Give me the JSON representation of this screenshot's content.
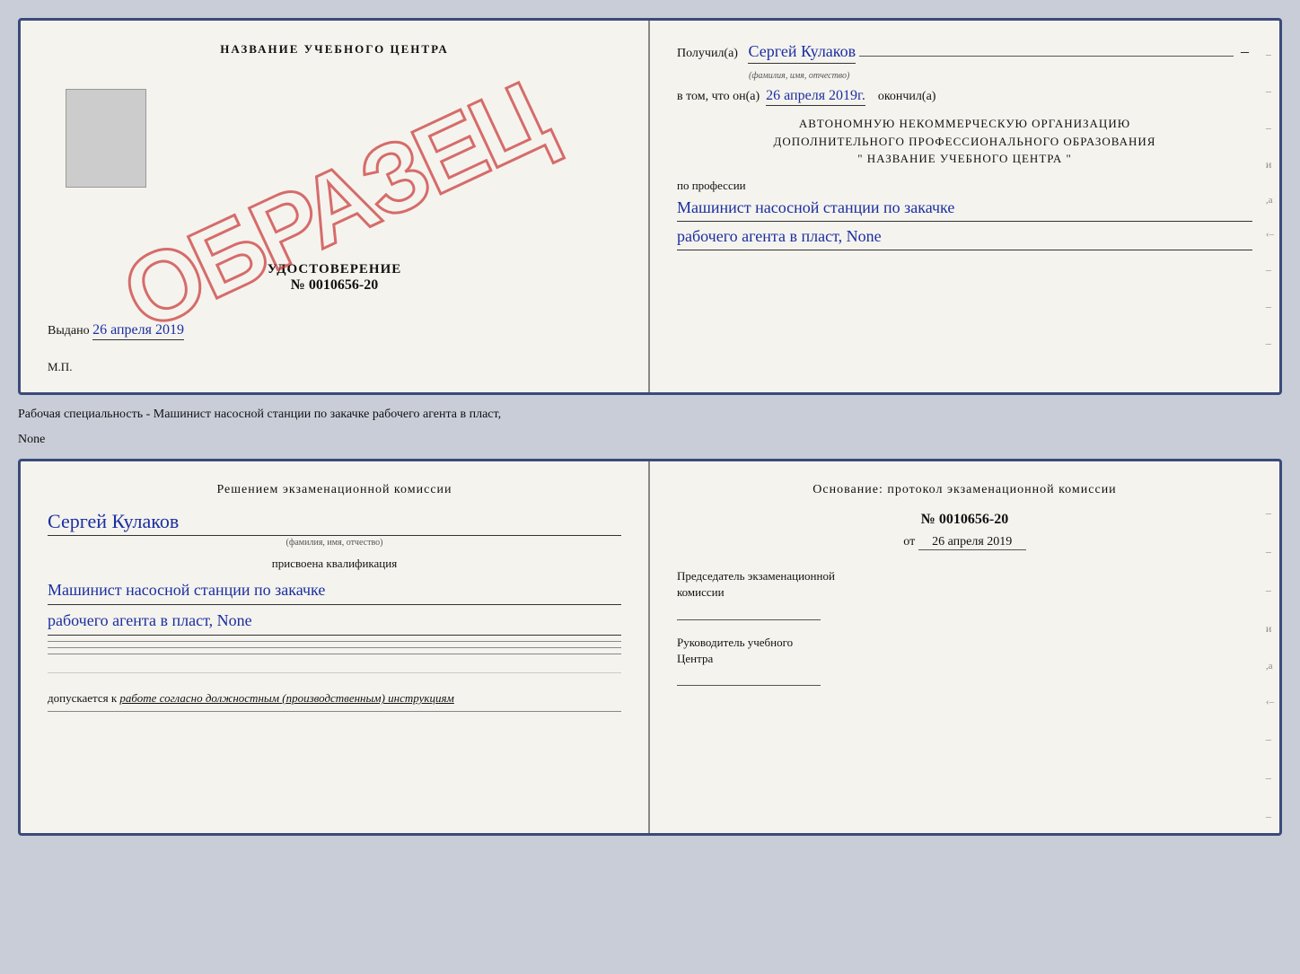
{
  "cert_top": {
    "left": {
      "title": "НАЗВАНИЕ УЧЕБНОГО ЦЕНТРА",
      "watermark": "ОБРАЗЕЦ",
      "udostoverenie": "УДОСТОВЕРЕНИЕ",
      "number": "№ 0010656-20",
      "vydano_label": "Выдано",
      "vydano_date": "26 апреля 2019",
      "mp": "М.П."
    },
    "right": {
      "poluchil_label": "Получил(а)",
      "poluchil_name": "Сергей Кулаков",
      "fio_hint": "(фамилия, имя, отчество)",
      "vtom_label": "в том, что он(а)",
      "vtom_date": "26 апреля 2019г.",
      "okonchil_label": "окончил(а)",
      "org_line1": "АВТОНОМНУЮ НЕКОММЕРЧЕСКУЮ ОРГАНИЗАЦИЮ",
      "org_line2": "ДОПОЛНИТЕЛЬНОГО ПРОФЕССИОНАЛЬНОГО ОБРАЗОВАНИЯ",
      "org_line3": "\"  НАЗВАНИЕ УЧЕБНОГО ЦЕНТРА  \"",
      "po_professii": "по профессии",
      "profession_line1": "Машинист насосной станции по закачке",
      "profession_line2": "рабочего агента в пласт, None"
    }
  },
  "caption": {
    "text1": "Рабочая специальность - Машинист насосной станции по закачке рабочего агента в пласт,",
    "text2": "None"
  },
  "cert_bottom": {
    "left": {
      "resheniem_text": "Решением  экзаменационной  комиссии",
      "name": "Сергей Кулаков",
      "fio_hint": "(фамилия, имя, отчество)",
      "prisvoena": "присвоена квалификация",
      "kvalif_line1": "Машинист насосной станции по закачке",
      "kvalif_line2": "рабочего агента в пласт, None",
      "dopuskaetsya_label": "допускается к",
      "dopuskaetsya_text": "работе согласно должностным (производственным) инструкциям"
    },
    "right": {
      "osnov_label": "Основание: протокол экзаменационной  комиссии",
      "protocol_number": "№  0010656-20",
      "ot_label": "от",
      "ot_date": "26 апреля 2019",
      "predsedatel_label": "Председатель экзаменационной",
      "komisii_label": "комиссии",
      "rukovoditel_label": "Руководитель учебного",
      "centra_label": "Центра"
    }
  },
  "dashes": [
    "-",
    "-",
    "-",
    "-",
    "-",
    "-",
    "-",
    "-"
  ]
}
